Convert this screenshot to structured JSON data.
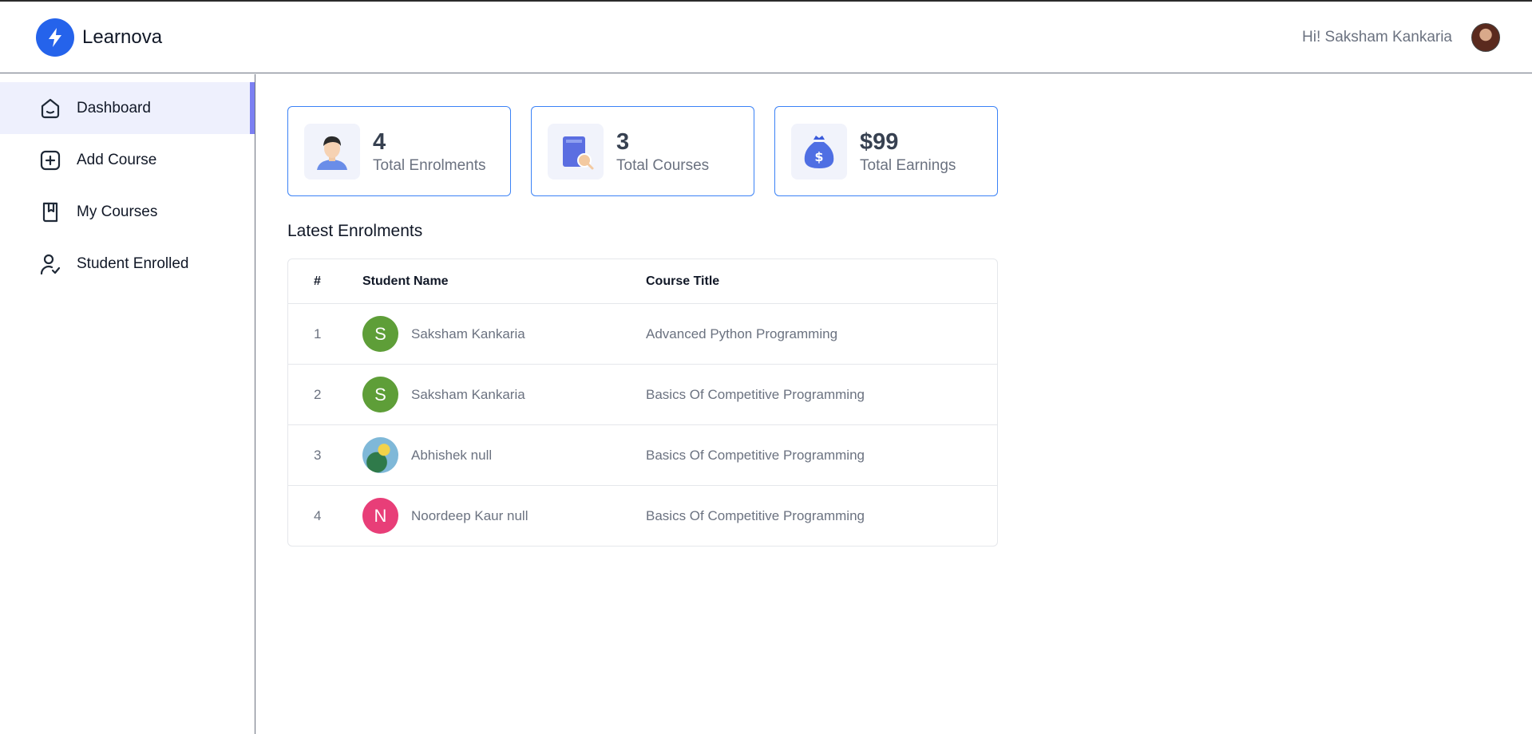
{
  "app": {
    "name": "Learnova"
  },
  "header": {
    "greeting": "Hi! Saksham Kankaria"
  },
  "sidebar": {
    "items": [
      {
        "label": "Dashboard",
        "icon": "home-icon",
        "active": true
      },
      {
        "label": "Add Course",
        "icon": "add-square-icon"
      },
      {
        "label": "My Courses",
        "icon": "bookmark-book-icon"
      },
      {
        "label": "Student Enrolled",
        "icon": "user-check-icon"
      }
    ]
  },
  "stats": [
    {
      "value": "4",
      "label": "Total Enrolments",
      "icon": "student-avatar-icon"
    },
    {
      "value": "3",
      "label": "Total Courses",
      "icon": "book-search-icon"
    },
    {
      "value": "$99",
      "label": "Total Earnings",
      "icon": "money-bag-icon"
    }
  ],
  "enrolments": {
    "title": "Latest Enrolments",
    "columns": [
      "#",
      "Student Name",
      "Course Title"
    ],
    "rows": [
      {
        "num": "1",
        "initial": "S",
        "avatar_color": "#5e9e38",
        "name": "Saksham Kankaria",
        "course": "Advanced Python Programming"
      },
      {
        "num": "2",
        "initial": "S",
        "avatar_color": "#5e9e38",
        "name": "Saksham Kankaria",
        "course": "Basics Of Competitive Programming"
      },
      {
        "num": "3",
        "initial": "",
        "avatar_color": "#7fb8d8",
        "name": "Abhishek null",
        "course": "Basics Of Competitive Programming"
      },
      {
        "num": "4",
        "initial": "N",
        "avatar_color": "#e83e78",
        "name": "Noordeep Kaur null",
        "course": "Basics Of Competitive Programming"
      }
    ]
  },
  "colors": {
    "accent": "#2563eb",
    "active_bar": "#7b7ff2",
    "active_bg": "#eef0fd",
    "card_border": "#3b82f6"
  }
}
